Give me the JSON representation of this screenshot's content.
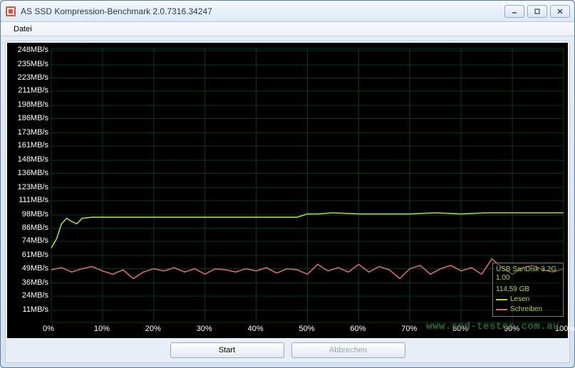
{
  "window": {
    "title": "AS SSD Kompression-Benchmark 2.0.7316.34247",
    "menu": {
      "file": "Datei"
    },
    "buttons": {
      "start": "Start",
      "cancel": "Abbrechen"
    }
  },
  "legend": {
    "device": "USB  SanDisk 3.2G",
    "version": "1.00",
    "capacity": "114,59 GB",
    "read": "Lesen",
    "write": "Schreiben",
    "read_color": "#a8d83a",
    "write_color": "#d46a6a"
  },
  "watermark": "www.ssd-tester.com.au",
  "chart_data": {
    "type": "line",
    "title": "",
    "xlabel": "",
    "ylabel": "",
    "xlim": [
      0,
      100
    ],
    "ylim": [
      0,
      250
    ],
    "y_ticks": [
      11,
      24,
      36,
      49,
      61,
      74,
      86,
      98,
      111,
      123,
      136,
      148,
      161,
      173,
      186,
      198,
      211,
      223,
      235,
      248
    ],
    "y_tick_labels": [
      "11MB/s",
      "24MB/s",
      "36MB/s",
      "49MB/s",
      "61MB/s",
      "74MB/s",
      "86MB/s",
      "98MB/s",
      "111MB/s",
      "123MB/s",
      "136MB/s",
      "148MB/s",
      "161MB/s",
      "173MB/s",
      "186MB/s",
      "198MB/s",
      "211MB/s",
      "223MB/s",
      "235MB/s",
      "248MB/s"
    ],
    "x_ticks": [
      0,
      10,
      20,
      30,
      40,
      50,
      60,
      70,
      80,
      90,
      100
    ],
    "x_tick_labels": [
      "0%",
      "10%",
      "20%",
      "30%",
      "40%",
      "50%",
      "60%",
      "70%",
      "80%",
      "90%",
      "100%"
    ],
    "series": [
      {
        "name": "Lesen",
        "color": "#a8d83a",
        "x": [
          0,
          1,
          2,
          3,
          4,
          5,
          6,
          8,
          10,
          15,
          20,
          25,
          30,
          35,
          40,
          45,
          48,
          50,
          52,
          55,
          60,
          65,
          70,
          75,
          80,
          85,
          90,
          95,
          100
        ],
        "values": [
          68,
          76,
          90,
          95,
          92,
          90,
          95,
          96,
          96,
          96,
          96,
          96,
          96,
          96,
          96,
          96,
          96,
          99,
          99,
          100,
          99,
          99,
          99,
          100,
          99,
          100,
          100,
          100,
          100
        ]
      },
      {
        "name": "Schreiben",
        "color": "#d46a6a",
        "x": [
          0,
          2,
          4,
          6,
          8,
          10,
          12,
          14,
          16,
          18,
          20,
          22,
          24,
          26,
          28,
          30,
          32,
          34,
          36,
          38,
          40,
          42,
          44,
          46,
          48,
          50,
          52,
          54,
          56,
          58,
          60,
          62,
          64,
          66,
          68,
          70,
          72,
          74,
          76,
          78,
          80,
          82,
          84,
          86,
          88,
          90,
          92,
          94,
          96,
          98,
          100
        ],
        "values": [
          48,
          50,
          46,
          49,
          51,
          47,
          44,
          48,
          40,
          46,
          49,
          47,
          50,
          46,
          49,
          44,
          49,
          48,
          46,
          49,
          47,
          50,
          45,
          49,
          48,
          44,
          53,
          47,
          50,
          46,
          53,
          46,
          51,
          48,
          40,
          49,
          52,
          44,
          49,
          52,
          47,
          50,
          44,
          58,
          50,
          44,
          50,
          52,
          48,
          46,
          49
        ]
      }
    ]
  }
}
